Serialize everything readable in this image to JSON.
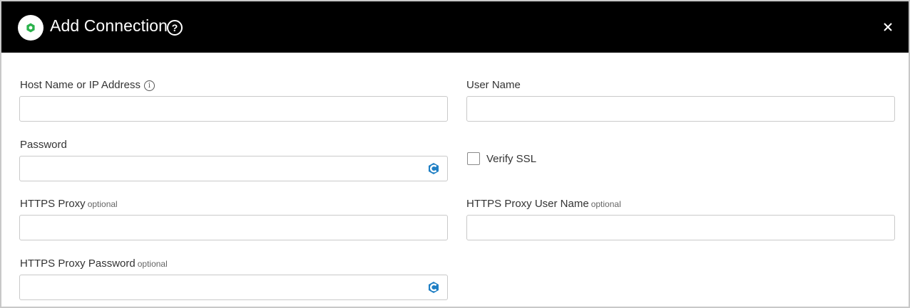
{
  "dialog": {
    "title": "Add Connection",
    "logo_icon": "hexagon-logo-icon",
    "help_icon": "question-circle-icon",
    "close_icon": "close-icon"
  },
  "form": {
    "host": {
      "label": "Host Name or IP Address",
      "info_icon": "info-icon",
      "value": ""
    },
    "username": {
      "label": "User Name",
      "value": ""
    },
    "password": {
      "label": "Password",
      "value": "",
      "vault_icon": "cyberark-vault-icon"
    },
    "verify_ssl": {
      "label": "Verify SSL",
      "checked": false
    },
    "https_proxy": {
      "label": "HTTPS Proxy",
      "optional": "optional",
      "value": ""
    },
    "https_proxy_username": {
      "label": "HTTPS Proxy User Name",
      "optional": "optional",
      "value": ""
    },
    "https_proxy_password": {
      "label": "HTTPS Proxy Password",
      "optional": "optional",
      "value": "",
      "vault_icon": "cyberark-vault-icon"
    }
  },
  "colors": {
    "header_bg": "#000000",
    "logo_green": "#2bb24c",
    "vault_blue": "#1f7fc4"
  }
}
